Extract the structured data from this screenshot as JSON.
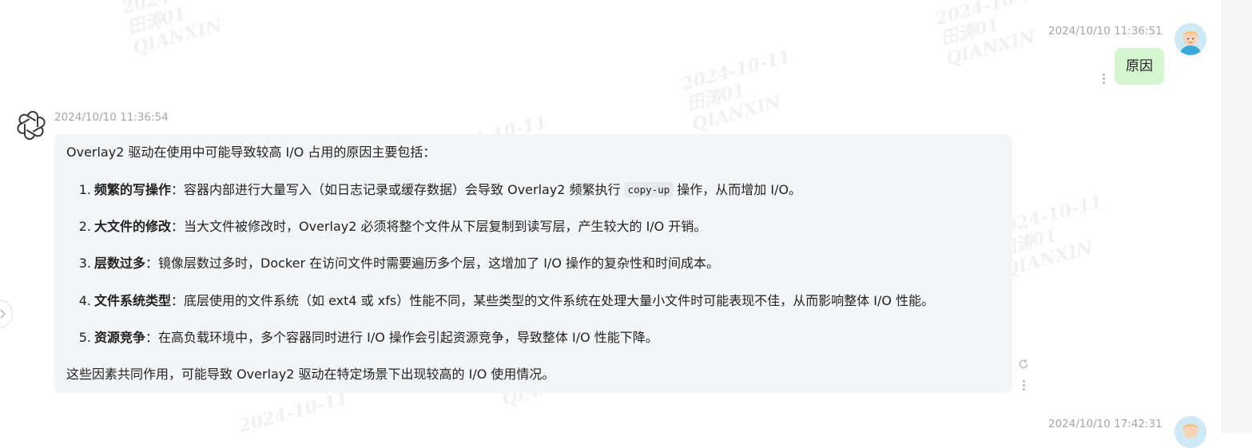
{
  "watermark": {
    "date": "2024-10-11",
    "name": "田涛01",
    "org": "QIANXIN"
  },
  "messages": {
    "user1": {
      "time": "2024/10/10 11:36:51",
      "text": "原因"
    },
    "bot1": {
      "time": "2024/10/10 11:36:54",
      "intro": "Overlay2 驱动在使用中可能导致较高 I/O 占用的原因主要包括：",
      "items": [
        {
          "num": "1.",
          "title": "频繁的写操作",
          "text_before": "：容器内部进行大量写入（如日志记录或缓存数据）会导致 Overlay2 频繁执行",
          "code": "copy-up",
          "text_after": "操作，从而增加 I/O。"
        },
        {
          "num": "2.",
          "title": "大文件的修改",
          "text": "：当大文件被修改时，Overlay2 必须将整个文件从下层复制到读写层，产生较大的 I/O 开销。"
        },
        {
          "num": "3.",
          "title": "层数过多",
          "text": "：镜像层数过多时，Docker 在访问文件时需要遍历多个层，这增加了 I/O 操作的复杂性和时间成本。"
        },
        {
          "num": "4.",
          "title": "文件系统类型",
          "text": "：底层使用的文件系统（如 ext4 或 xfs）性能不同，某些类型的文件系统在处理大量小文件时可能表现不佳，从而影响整体 I/O 性能。"
        },
        {
          "num": "5.",
          "title": "资源竞争",
          "text": "：在高负载环境中，多个容器同时进行 I/O 操作会引起资源竞争，导致整体 I/O 性能下降。"
        }
      ],
      "outro": "这些因素共同作用，可能导致 Overlay2 驱动在特定场景下出现较高的 I/O 使用情况。"
    },
    "user2": {
      "time": "2024/10/10 17:42:31"
    }
  },
  "colors": {
    "user_bubble": "#d5f5d0",
    "answer_card": "#f4f5f7",
    "timestamp": "#a6a6a6"
  }
}
